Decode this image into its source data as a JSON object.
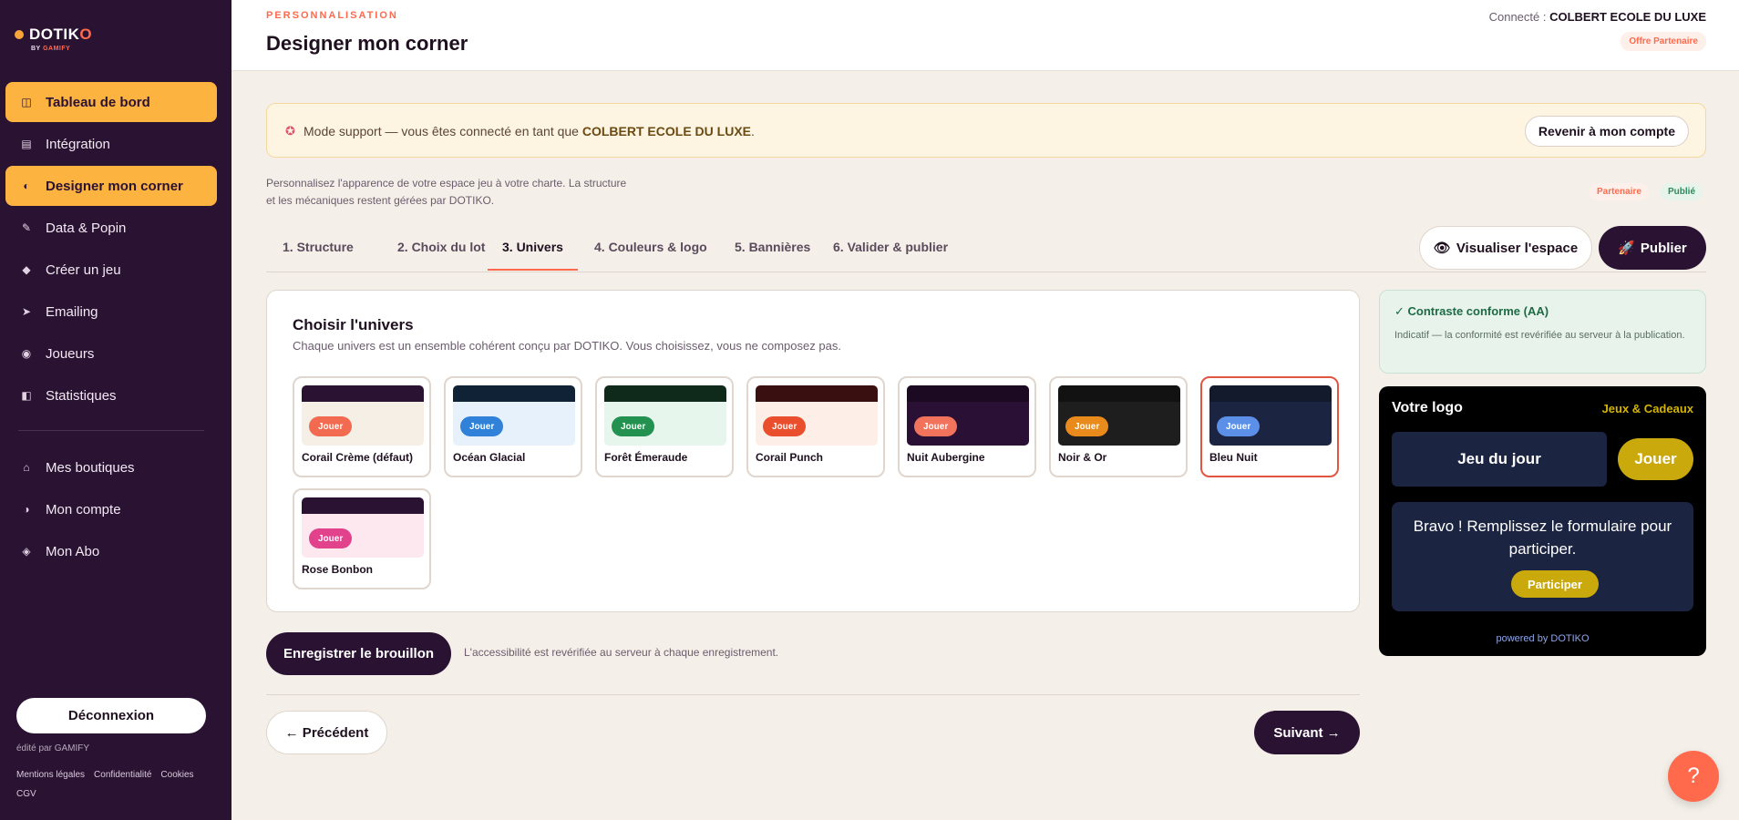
{
  "brand": {
    "name_main": "DOTIK",
    "name_accent": "O",
    "by": "BY",
    "by_brand": "GAMIFY"
  },
  "sidebar": {
    "items": [
      {
        "label": "Tableau de bord",
        "icon": "grid-icon"
      },
      {
        "label": "Intégration",
        "icon": "list-icon"
      },
      {
        "label": "Designer mon corner",
        "icon": "palette-icon"
      },
      {
        "label": "Data & Popin",
        "icon": "pencil-icon"
      },
      {
        "label": "Créer un jeu",
        "icon": "diamond-icon"
      },
      {
        "label": "Emailing",
        "icon": "send-icon"
      },
      {
        "label": "Joueurs",
        "icon": "target-icon"
      },
      {
        "label": "Statistiques",
        "icon": "chart-icon"
      }
    ],
    "secondary": [
      {
        "label": "Mes boutiques",
        "icon": "home-icon"
      },
      {
        "label": "Mon compte",
        "icon": "user-icon"
      },
      {
        "label": "Mon Abo",
        "icon": "badge-icon"
      }
    ],
    "logout": "Déconnexion",
    "edited_by": "édité par GAMIFY",
    "legal": [
      "Mentions légales",
      "Confidentialité",
      "Cookies",
      "CGV"
    ]
  },
  "header": {
    "kicker": "PERSONNALISATION",
    "title": "Designer mon corner",
    "connected_label": "Connecté :",
    "connected_user": "COLBERT ECOLE DU LUXE",
    "badge": "Offre Partenaire"
  },
  "support": {
    "text_before": "Mode support — vous êtes connecté en tant que ",
    "user": "COLBERT ECOLE DU LUXE",
    "text_after": ".",
    "button": "Revenir à mon compte"
  },
  "intro": {
    "line1": "Personnalisez l'apparence de votre espace jeu à votre charte. La structure",
    "line2": "et les mécaniques restent gérées par DOTIKO.",
    "tag_partner": "Partenaire",
    "tag_published": "Publié"
  },
  "tabs": [
    "1. Structure",
    "2. Choix du lot",
    "3. Univers",
    "4. Couleurs & logo",
    "5. Bannières",
    "6. Valider & publier"
  ],
  "actions": {
    "preview": "Visualiser l'espace",
    "publish": "Publier"
  },
  "universe": {
    "title": "Choisir l'univers",
    "subtitle": "Chaque univers est un ensemble cohérent conçu par DOTIKO. Vous choisissez, vous ne composez pas.",
    "play_label": "Jouer",
    "selected": "Bleu Nuit",
    "themes": [
      {
        "name": "Corail Crème (défaut)",
        "bar": "#2a1233",
        "bg": "#f6efe6",
        "pill": "#f26a4f"
      },
      {
        "name": "Océan Glacial",
        "bar": "#0f2236",
        "bg": "#e7f1fb",
        "pill": "#2f82d8"
      },
      {
        "name": "Forêt Émeraude",
        "bar": "#0f2a1a",
        "bg": "#e7f6ec",
        "pill": "#23914f"
      },
      {
        "name": "Corail Punch",
        "bar": "#3a0f0f",
        "bg": "#fdeee8",
        "pill": "#e94f2c"
      },
      {
        "name": "Nuit Aubergine",
        "bar": "#1c0a22",
        "bg": "#2b1035",
        "pill": "#f2735c"
      },
      {
        "name": "Noir & Or",
        "bar": "#121212",
        "bg": "#1e1e1e",
        "pill": "#e98a1c"
      },
      {
        "name": "Bleu Nuit",
        "bar": "#121a2c",
        "bg": "#1b2440",
        "pill": "#5b8fe8"
      },
      {
        "name": "Rose Bonbon",
        "bar": "#2a1233",
        "bg": "#fde8f0",
        "pill": "#e2418b"
      }
    ]
  },
  "draft": {
    "button": "Enregistrer le brouillon",
    "note": "L'accessibilité est revérifiée au serveur à chaque enregistrement."
  },
  "nav_buttons": {
    "prev": "← Précédent",
    "next": "Suivant →"
  },
  "contrast": {
    "title": "✓ Contraste conforme (AA)",
    "text": "Indicatif — la conformité est revérifiée au serveur à la publication."
  },
  "preview": {
    "logo": "Votre logo",
    "brand": "Jeux & Cadeaux",
    "game": "Jeu du jour",
    "play": "Jouer",
    "message": "Bravo ! Remplissez le formulaire pour participer.",
    "cta": "Participer",
    "powered": "powered by DOTIKO"
  },
  "help": "?"
}
